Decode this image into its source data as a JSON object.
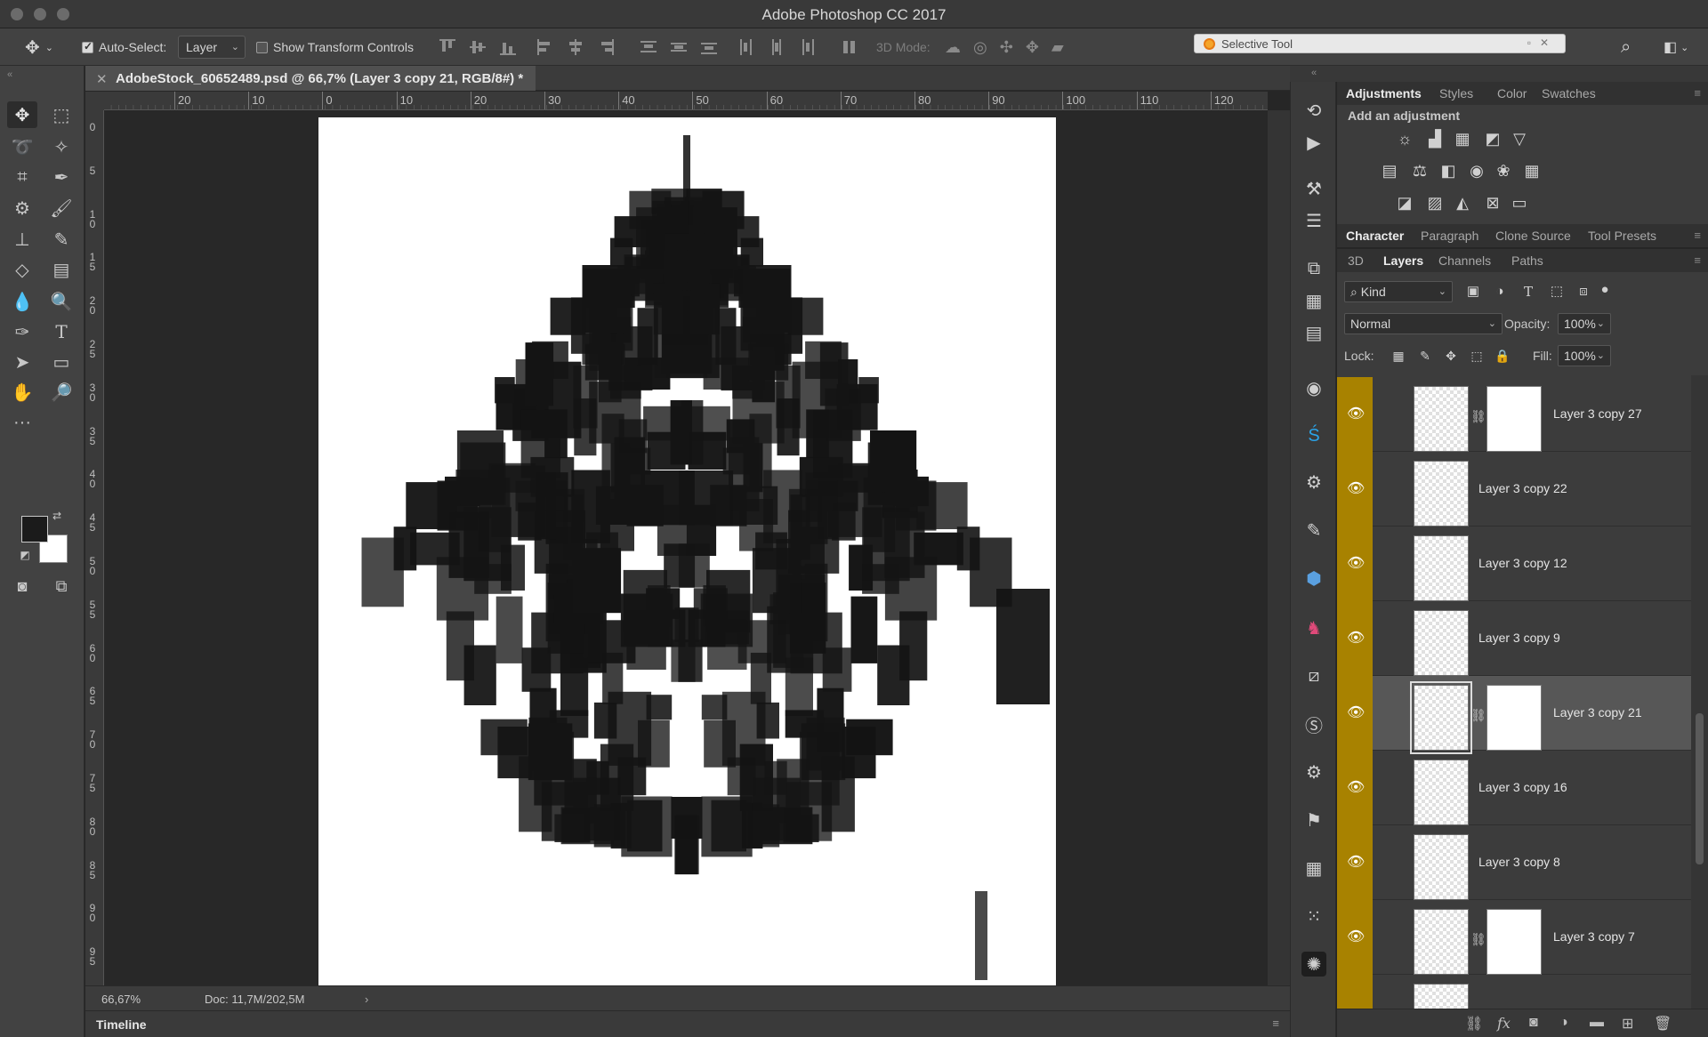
{
  "window": {
    "title": "Adobe Photoshop CC 2017"
  },
  "options": {
    "auto_select_label": "Auto-Select:",
    "auto_select_value": "Layer",
    "transform_label": "Show Transform Controls",
    "mode_label": "3D Mode:",
    "selective_tool": "Selective Tool"
  },
  "document": {
    "tab_title": "AdobeStock_60652489.psd @ 66,7% (Layer 3 copy 21, RGB/8#) *",
    "ruler_top": [
      "20",
      "10",
      "0",
      "10",
      "20",
      "30",
      "40",
      "50",
      "60",
      "70",
      "80",
      "90",
      "100",
      "110",
      "120"
    ],
    "ruler_left": [
      "0",
      "5",
      "10",
      "15",
      "20",
      "25",
      "30",
      "35",
      "40",
      "45",
      "50",
      "55",
      "60",
      "65",
      "70",
      "75",
      "80",
      "85",
      "90",
      "95"
    ]
  },
  "status": {
    "zoom": "66,67%",
    "doc": "Doc: 11,7M/202,5M"
  },
  "timeline": {
    "label": "Timeline"
  },
  "adjustments": {
    "tabs": [
      "Adjustments",
      "Styles",
      "Color",
      "Swatches"
    ],
    "subtitle": "Add an adjustment"
  },
  "character_tabs": [
    "Character",
    "Paragraph",
    "Clone Source",
    "Tool Presets"
  ],
  "layers_tabs": [
    "3D",
    "Layers",
    "Channels",
    "Paths"
  ],
  "layers_controls": {
    "filter": "Kind",
    "blend_mode": "Normal",
    "opacity_label": "Opacity:",
    "opacity_value": "100%",
    "lock_label": "Lock:",
    "fill_label": "Fill:",
    "fill_value": "100%"
  },
  "layers": [
    {
      "name": "Layer 3 copy 27",
      "mask": true,
      "selected": false
    },
    {
      "name": "Layer 3 copy 22",
      "mask": false,
      "selected": false
    },
    {
      "name": "Layer 3 copy 12",
      "mask": false,
      "selected": false
    },
    {
      "name": "Layer 3 copy 9",
      "mask": false,
      "selected": false
    },
    {
      "name": "Layer 3 copy 21",
      "mask": true,
      "selected": true
    },
    {
      "name": "Layer 3 copy 16",
      "mask": false,
      "selected": false
    },
    {
      "name": "Layer 3 copy 8",
      "mask": false,
      "selected": false
    },
    {
      "name": "Layer 3 copy 7",
      "mask": true,
      "selected": false
    }
  ],
  "colors": {
    "layer_visibility_column": "#a88200",
    "foreground": "#1b1b1b",
    "background": "#ffffff"
  }
}
